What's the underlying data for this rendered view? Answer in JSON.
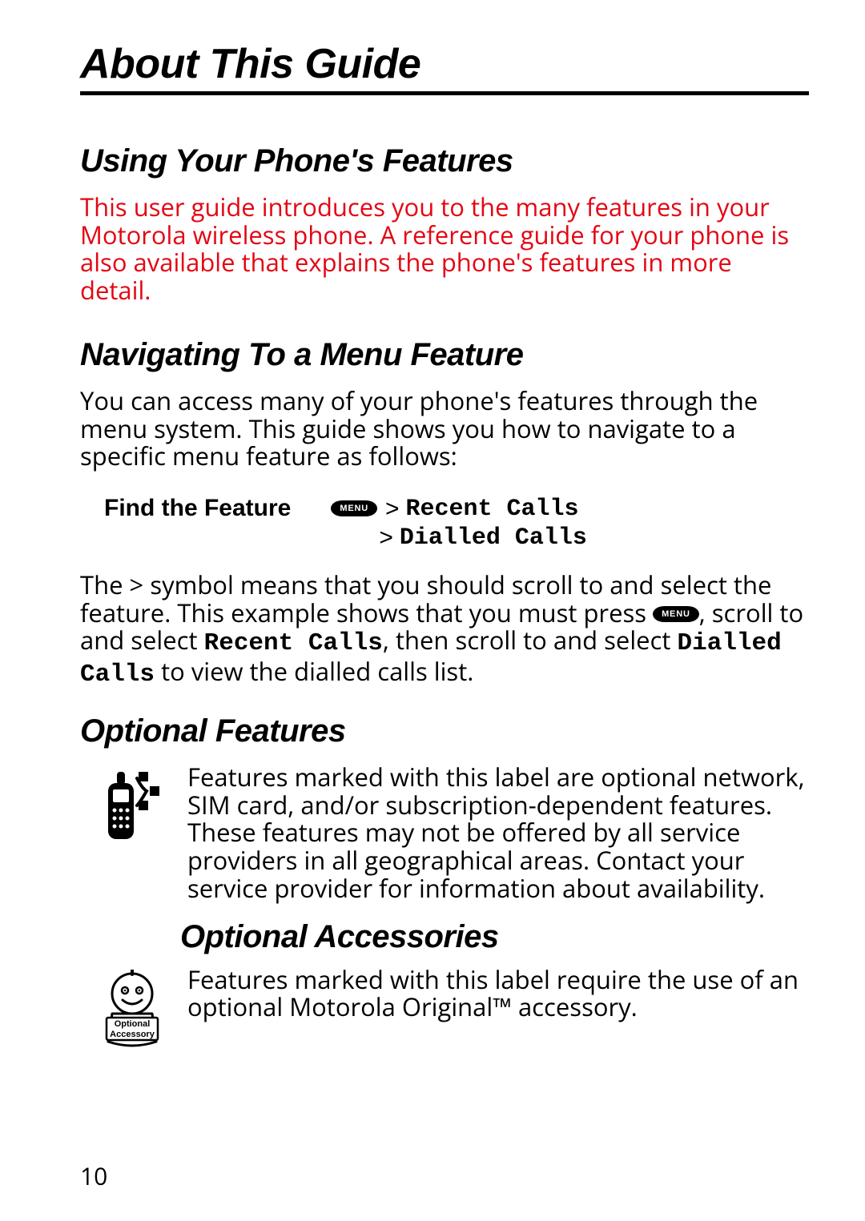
{
  "page_title": "About This Guide",
  "page_number": "10",
  "sections": {
    "using": {
      "heading": "Using Your Phone's Features",
      "body": "This user guide introduces you to the many features in your Motorola wireless phone. A reference guide for your phone is also available that explains the phone's features in more detail."
    },
    "navigating": {
      "heading": "Navigating To a Menu Feature",
      "intro": "You can access many of your phone's features through the menu system. This guide shows you how to navigate to a specific menu feature as follows:",
      "find_label": "Find the Feature",
      "menu_key_label": "MENU",
      "nav": {
        "step1": "Recent Calls",
        "step2": "Dialled Calls",
        "gt": ">"
      },
      "explain_pre": "The > symbol means that you should scroll to and select the feature. This example shows that you must press ",
      "explain_mid": ", scroll to and select ",
      "explain_item1": "Recent Calls",
      "explain_sep": ", then scroll to and select ",
      "explain_item2": "Dialled Calls",
      "explain_post": " to view the dialled calls list."
    },
    "optional_features": {
      "heading": "Optional Features",
      "body": "Features marked with this label are optional network, SIM card, and/or subscription-dependent features. These features may not be offered by all service providers in all geographical areas. Contact your service provider for information about availability."
    },
    "optional_accessories": {
      "heading": "Optional Accessories",
      "body": "Features marked with this label require the use of an optional Motorola Original™ accessory.",
      "icon_label_top": "Optional",
      "icon_label_bottom": "Accessory"
    }
  }
}
